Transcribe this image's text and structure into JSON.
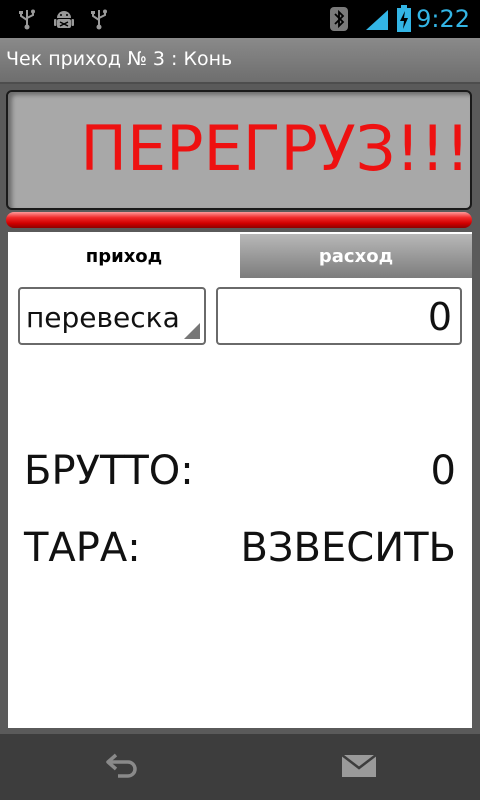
{
  "status_bar": {
    "time": "9:22",
    "icons": [
      "usb-icon",
      "android-debug-icon",
      "usb-icon",
      "bluetooth-icon",
      "signal-icon",
      "battery-charging-icon"
    ]
  },
  "title": "Чек приход № 3 : Конь",
  "weight_display": {
    "text": "ПЕРЕГРУЗ!!!"
  },
  "overload_indicator": {
    "color": "#e81a1a"
  },
  "tabs": [
    {
      "label": "приход",
      "selected": true
    },
    {
      "label": "расход",
      "selected": false
    }
  ],
  "mode_selector": {
    "value": "перевеска"
  },
  "weight_input": {
    "value": "0"
  },
  "rows": [
    {
      "label": "БРУТТО:",
      "value": "0"
    },
    {
      "label": "ТАРА:",
      "value": "ВЗВЕСИТЬ"
    }
  ],
  "nav_bar": {
    "back_icon": "back-icon",
    "message_icon": "envelope-icon"
  },
  "colors": {
    "accent": "#33b5e5",
    "overload_text": "#ee1111",
    "display_bg": "#a8a8a8"
  }
}
